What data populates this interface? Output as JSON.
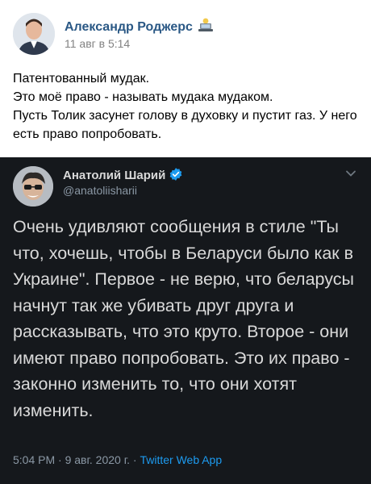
{
  "post": {
    "author": "Александр Роджерс",
    "author_emoji": "computer-user-emoji",
    "date": "11 авг в 5:14",
    "text_lines": [
      "Патентованный мудак.",
      "Это моё право - называть мудака мудаком.",
      "Пусть Толик засунет голову в духовку и пустит газ. У него есть право попробовать."
    ]
  },
  "tweet": {
    "name": "Анатолий Шарий",
    "handle": "@anatoliisharii",
    "verified_icon": "verified-badge-icon",
    "menu_icon": "chevron-down-icon",
    "text": "Очень удивляют сообщения в стиле \"Ты что, хочешь, чтобы в Беларуси было как в Украине\". Первое - не верю, что беларусы начнут так же убивать друг друга и рассказывать, что это круто. Второе - они имеют право попробовать. Это их право - законно изменить то, что они хотят изменить.",
    "time": "5:04 PM",
    "date": "9 авг. 2020 г.",
    "separator": " · ",
    "source": "Twitter Web App"
  },
  "colors": {
    "vk_link": "#2a5885",
    "tweet_bg": "#15181c",
    "twitter_blue": "#1d9bf0",
    "muted": "#8b98a5"
  }
}
